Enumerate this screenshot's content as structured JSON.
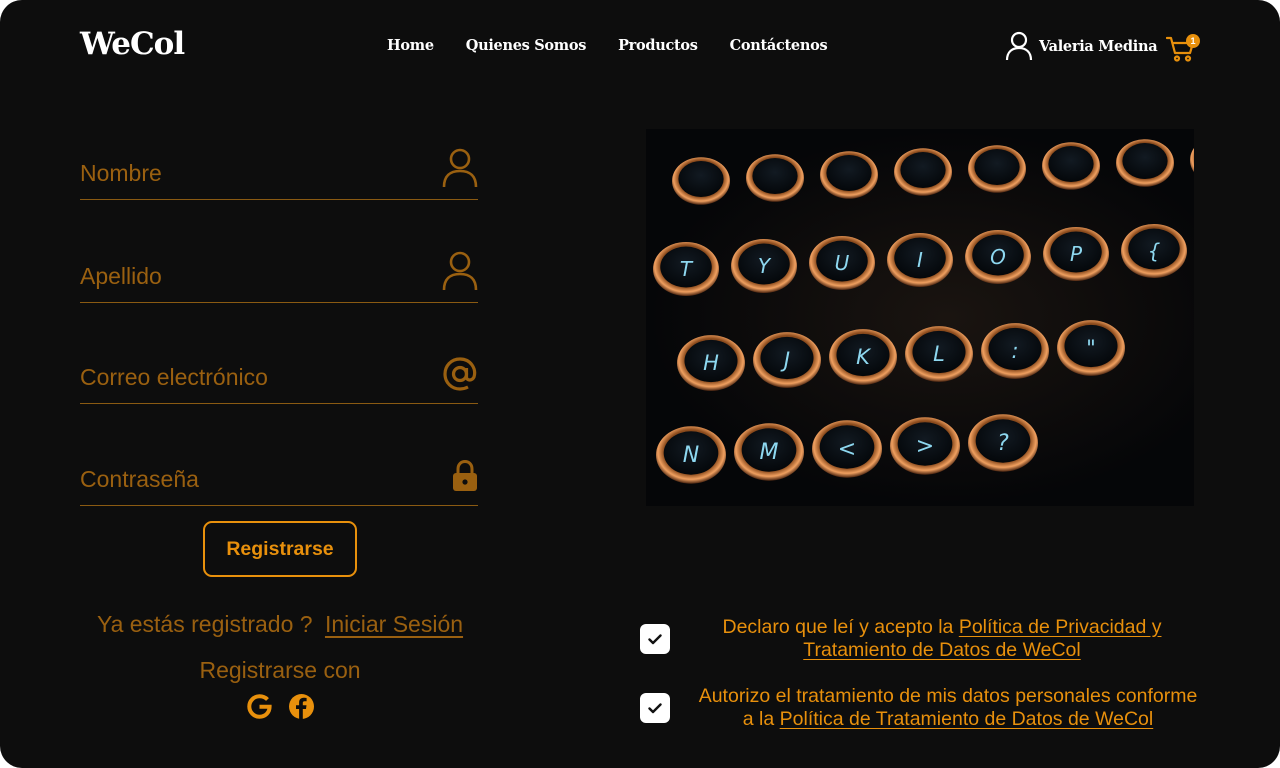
{
  "brand": {
    "logo": "WeCol"
  },
  "nav": {
    "home": "Home",
    "about": "Quienes Somos",
    "products": "Productos",
    "contact": "Contáctenos"
  },
  "user": {
    "name": "Valeria Medina",
    "cart_count": "1"
  },
  "form": {
    "first_name_placeholder": "Nombre",
    "last_name_placeholder": "Apellido",
    "email_placeholder": "Correo electrónico",
    "password_placeholder": "Contraseña",
    "register_button": "Registrarse",
    "already_registered": "Ya estás registrado ?",
    "login_link": "Iniciar Sesión",
    "register_with": "Registrarse con"
  },
  "consents": {
    "privacy_text": "Declaro que leí y acepto la",
    "privacy_link": "Política de Privacidad y Tratamiento de Datos de WeCol",
    "data_text_1": "Autorizo el tratamiento de mis datos personales conforme",
    "data_text_2": "a la",
    "data_link": "Política de Tratamiento de Datos de WeCol"
  },
  "keyboard": {
    "row1": [
      "",
      "",
      "",
      "",
      "",
      "",
      "",
      ""
    ],
    "row2": [
      "T",
      "Y",
      "U",
      "I",
      "O",
      "P",
      "{"
    ],
    "row3": [
      "H",
      "J",
      "K",
      "L",
      ":",
      "\""
    ],
    "row4": [
      "N",
      "M",
      "<",
      ">",
      "?"
    ]
  },
  "colors": {
    "accent": "#e8900c",
    "muted_accent": "#9a6010",
    "background": "#0d0d0d",
    "text": "#ffffff"
  },
  "icons": [
    "user-icon",
    "cart-icon",
    "at-icon",
    "lock-icon",
    "google-icon",
    "facebook-icon",
    "check-icon"
  ]
}
